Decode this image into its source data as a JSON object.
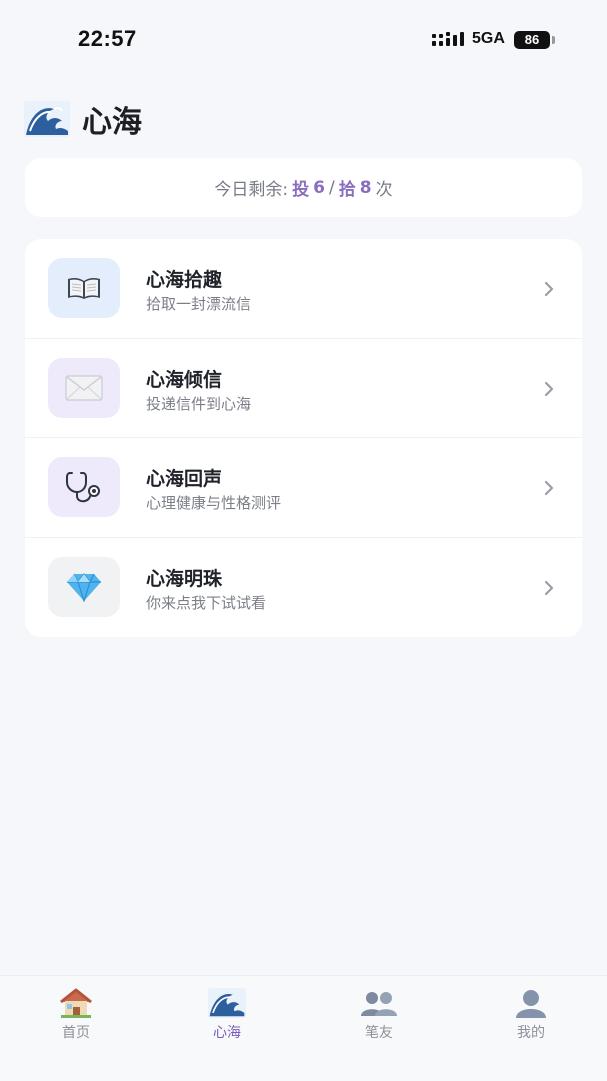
{
  "status_bar": {
    "time": "22:57",
    "network": "5GA",
    "battery": "86"
  },
  "header": {
    "title": "心海",
    "icon": "wave-icon"
  },
  "quota": {
    "prefix": "今日剩余:",
    "send_label": "投",
    "send_count": "6",
    "separator": "/",
    "pick_label": "拾",
    "pick_count": "8",
    "suffix": "次"
  },
  "menu": [
    {
      "title": "心海拾趣",
      "subtitle": "拾取一封漂流信",
      "icon": "open-book-icon",
      "bg": "#e3edfb"
    },
    {
      "title": "心海倾信",
      "subtitle": "投递信件到心海",
      "icon": "envelope-icon",
      "bg": "#eeeafb"
    },
    {
      "title": "心海回声",
      "subtitle": "心理健康与性格测评",
      "icon": "stethoscope-icon",
      "bg": "#eeeafb"
    },
    {
      "title": "心海明珠",
      "subtitle": "你来点我下试试看",
      "icon": "gem-icon",
      "bg": "#f1f2f4"
    }
  ],
  "tabs": [
    {
      "label": "首页",
      "icon": "house-icon",
      "active": false
    },
    {
      "label": "心海",
      "icon": "wave-icon",
      "active": true
    },
    {
      "label": "笔友",
      "icon": "people-icon",
      "active": false
    },
    {
      "label": "我的",
      "icon": "person-icon",
      "active": false
    }
  ],
  "colors": {
    "accent": "#7b5cb8",
    "count": "#8b6dc0",
    "background": "#f6f7fa"
  }
}
